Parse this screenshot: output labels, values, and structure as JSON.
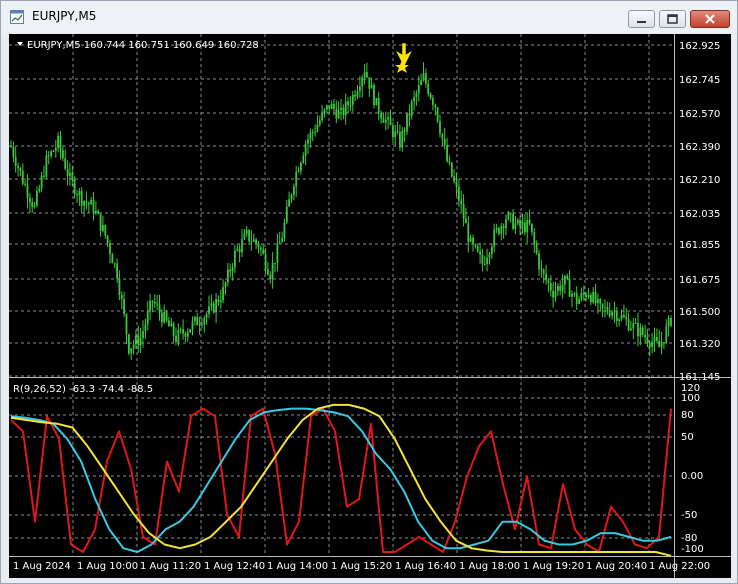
{
  "window": {
    "title": "EURJPY,M5"
  },
  "main_chart": {
    "header": "EURJPY,M5  160.744 160.751 160.649 160.728",
    "price_ticks": [
      "162.925",
      "162.745",
      "162.570",
      "162.390",
      "162.210",
      "162.035",
      "161.855",
      "161.675",
      "161.500",
      "161.320",
      "161.145"
    ]
  },
  "indicator": {
    "header": "R(9,26,52) -63.3 -74.4 -88.5",
    "scale_ticks": [
      "120",
      "100",
      "80",
      "50",
      "0.00",
      "-50",
      "-80",
      "-100"
    ]
  },
  "time_axis": [
    "1 Aug 2024",
    "1 Aug 10:00",
    "1 Aug 11:20",
    "1 Aug 12:40",
    "1 Aug 14:00",
    "1 Aug 15:20",
    "1 Aug 16:40",
    "1 Aug 18:00",
    "1 Aug 19:20",
    "1 Aug 20:40",
    "1 Aug 22:00"
  ],
  "colors": {
    "background": "#000000",
    "grid": "#8c8c8c",
    "candles": "#3cc83c",
    "fast_line": "#e01818",
    "mid_line": "#39c9e3",
    "slow_line": "#f2e33a",
    "marker": "#ffe400"
  },
  "chart_data": [
    {
      "type": "candlestick",
      "title": "EURJPY,M5",
      "ohlc_last": {
        "open": 160.744,
        "high": 160.751,
        "low": 160.649,
        "close": 160.728
      },
      "ylim": [
        161.145,
        162.925
      ],
      "close_path": [
        [
          0,
          162.38
        ],
        [
          5,
          162.2
        ],
        [
          10,
          162.05
        ],
        [
          15,
          162.3
        ],
        [
          20,
          162.4
        ],
        [
          25,
          162.2
        ],
        [
          30,
          162.1
        ],
        [
          35,
          162.05
        ],
        [
          40,
          161.9
        ],
        [
          45,
          161.7
        ],
        [
          50,
          161.3
        ],
        [
          55,
          161.35
        ],
        [
          60,
          161.55
        ],
        [
          65,
          161.45
        ],
        [
          70,
          161.35
        ],
        [
          75,
          161.4
        ],
        [
          80,
          161.45
        ],
        [
          85,
          161.5
        ],
        [
          90,
          161.6
        ],
        [
          95,
          161.8
        ],
        [
          100,
          161.9
        ],
        [
          105,
          161.85
        ],
        [
          110,
          161.7
        ],
        [
          115,
          161.9
        ],
        [
          120,
          162.2
        ],
        [
          125,
          162.4
        ],
        [
          130,
          162.5
        ],
        [
          135,
          162.6
        ],
        [
          140,
          162.55
        ],
        [
          145,
          162.65
        ],
        [
          150,
          162.8
        ],
        [
          155,
          162.6
        ],
        [
          160,
          162.5
        ],
        [
          165,
          162.4
        ],
        [
          170,
          162.6
        ],
        [
          175,
          162.75
        ],
        [
          180,
          162.6
        ],
        [
          185,
          162.3
        ],
        [
          190,
          162.1
        ],
        [
          195,
          161.85
        ],
        [
          200,
          161.75
        ],
        [
          205,
          161.9
        ],
        [
          210,
          162.0
        ],
        [
          215,
          161.95
        ],
        [
          220,
          161.95
        ],
        [
          225,
          161.7
        ],
        [
          230,
          161.6
        ],
        [
          235,
          161.65
        ],
        [
          240,
          161.55
        ],
        [
          245,
          161.6
        ],
        [
          250,
          161.5
        ],
        [
          255,
          161.5
        ],
        [
          260,
          161.45
        ],
        [
          265,
          161.4
        ],
        [
          270,
          161.35
        ],
        [
          275,
          161.3
        ],
        [
          280,
          161.45
        ]
      ]
    },
    {
      "type": "line",
      "title": "R(9,26,52)",
      "ylim": [
        -100,
        120
      ],
      "series": [
        {
          "name": "R(9)",
          "values": [
            75,
            60,
            -60,
            80,
            50,
            -90,
            -100,
            -70,
            20,
            60,
            10,
            -80,
            -90,
            20,
            -20,
            80,
            90,
            80,
            -50,
            -80,
            80,
            90,
            30,
            -90,
            -60,
            80,
            90,
            60,
            -40,
            -30,
            70,
            -100,
            -100,
            -90,
            -80,
            -90,
            -100,
            -60,
            0,
            40,
            60,
            -10,
            -70,
            0,
            -90,
            -95,
            -10,
            -70,
            -90,
            -100,
            -40,
            -60,
            -90,
            -95,
            -80,
            90
          ]
        },
        {
          "name": "R(26)",
          "values": [
            80,
            78,
            75,
            70,
            50,
            20,
            -30,
            -70,
            -95,
            -100,
            -90,
            -70,
            -60,
            -40,
            -10,
            20,
            50,
            75,
            85,
            88,
            90,
            90,
            88,
            85,
            80,
            60,
            30,
            10,
            -20,
            -60,
            -85,
            -95,
            -95,
            -90,
            -85,
            -60,
            -60,
            -70,
            -85,
            -90,
            -90,
            -85,
            -75,
            -75,
            -80,
            -85,
            -85,
            -80
          ]
        },
        {
          "name": "R(52)",
          "values": [
            78,
            75,
            72,
            70,
            65,
            40,
            10,
            -20,
            -50,
            -75,
            -90,
            -95,
            -90,
            -80,
            -60,
            -40,
            -10,
            20,
            50,
            75,
            90,
            95,
            95,
            90,
            80,
            50,
            10,
            -30,
            -60,
            -85,
            -95,
            -98,
            -100,
            -100,
            -100,
            -100,
            -100,
            -100,
            -100,
            -100,
            -100,
            -100,
            -100,
            -105
          ]
        }
      ]
    }
  ]
}
